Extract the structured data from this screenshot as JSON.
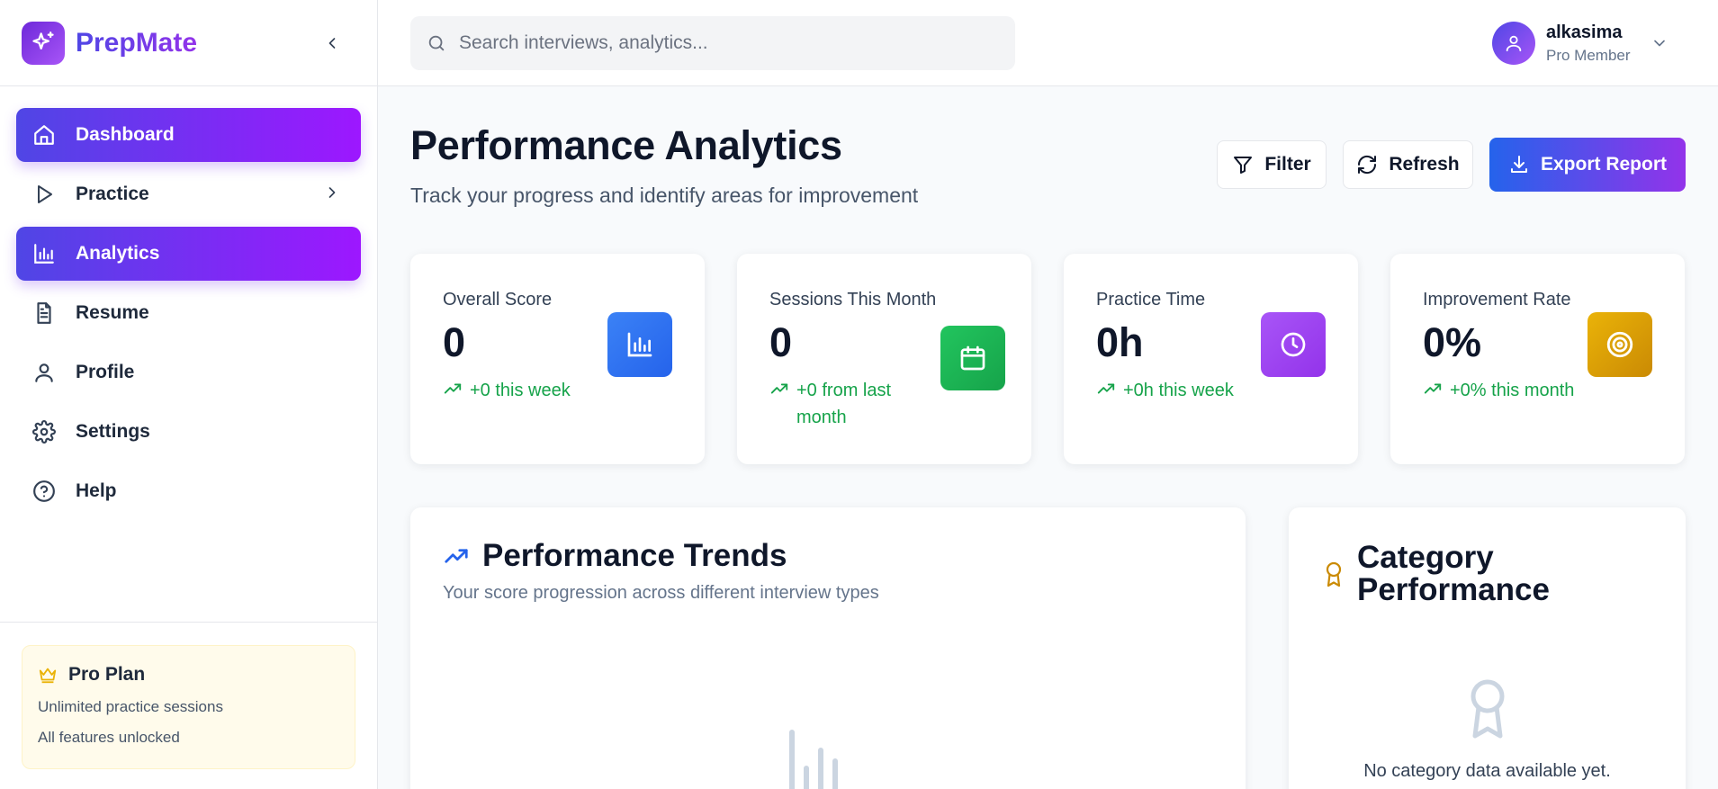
{
  "app": {
    "name": "PrepMate"
  },
  "sidebar": {
    "items": [
      {
        "label": "Dashboard",
        "icon": "home-icon",
        "active": true
      },
      {
        "label": "Practice",
        "icon": "play-icon",
        "active": false,
        "has_submenu": true
      },
      {
        "label": "Analytics",
        "icon": "bar-chart-icon",
        "active": true
      },
      {
        "label": "Resume",
        "icon": "document-icon",
        "active": false
      },
      {
        "label": "Profile",
        "icon": "user-icon",
        "active": false
      },
      {
        "label": "Settings",
        "icon": "gear-icon",
        "active": false
      },
      {
        "label": "Help",
        "icon": "help-circle-icon",
        "active": false
      }
    ],
    "plan": {
      "title": "Pro Plan",
      "lines": [
        "Unlimited practice sessions",
        "All features unlocked"
      ]
    }
  },
  "header": {
    "search_placeholder": "Search interviews, analytics...",
    "user": {
      "name": "alkasima",
      "role": "Pro Member"
    }
  },
  "page": {
    "title": "Performance Analytics",
    "subtitle": "Track your progress and identify areas for improvement",
    "actions": {
      "filter": "Filter",
      "refresh": "Refresh",
      "export": "Export Report"
    }
  },
  "stats": [
    {
      "label": "Overall Score",
      "value": "0",
      "delta": "+0 this week",
      "icon": "bar-chart-icon",
      "color": "#2563eb"
    },
    {
      "label": "Sessions This Month",
      "value": "0",
      "delta": "+0 from last month",
      "icon": "calendar-icon",
      "color": "#16a34a"
    },
    {
      "label": "Practice Time",
      "value": "0h",
      "delta": "+0h this week",
      "icon": "clock-icon",
      "color": "#9333ea"
    },
    {
      "label": "Improvement Rate",
      "value": "0%",
      "delta": "+0% this month",
      "icon": "target-icon",
      "color": "#ca8a04"
    }
  ],
  "panels": {
    "trends": {
      "title": "Performance Trends",
      "subtitle": "Your score progression across different interview types"
    },
    "category": {
      "title": "Category Performance",
      "empty": "No category data available yet."
    }
  },
  "colors": {
    "accent_start": "#4f46e5",
    "accent_end": "#9d17ff",
    "positive": "#16a34a"
  }
}
